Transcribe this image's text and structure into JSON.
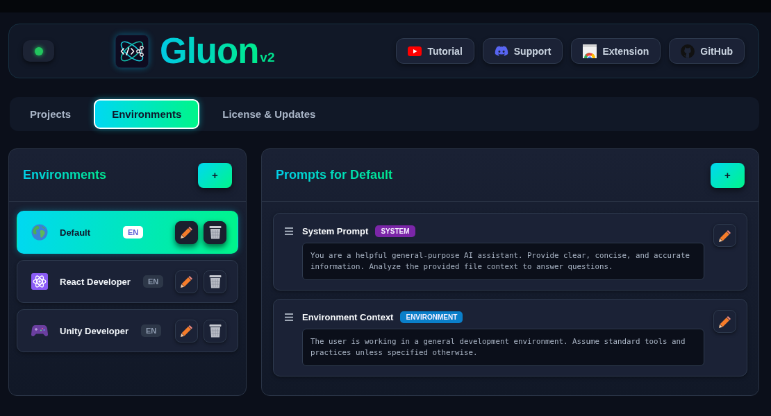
{
  "header": {
    "status": {
      "on": true
    },
    "logo": {
      "name": "Gluon",
      "version": "v2"
    },
    "links": [
      {
        "label": "Tutorial",
        "kind": "video"
      },
      {
        "label": "Support",
        "kind": "chat"
      },
      {
        "label": "Extension",
        "kind": "extension"
      },
      {
        "label": "GitHub",
        "kind": "repo"
      }
    ]
  },
  "tabs": [
    {
      "label": "Projects",
      "selected": false
    },
    {
      "label": "Environments",
      "selected": true
    },
    {
      "label": "License & Updates",
      "selected": false
    }
  ],
  "environments_panel": {
    "title": "Environments",
    "add_button": "+",
    "items": [
      {
        "name": "Default",
        "kind": "globe",
        "language": "EN",
        "selected": true
      },
      {
        "name": "React Developer",
        "kind": "atom",
        "language": "EN",
        "selected": false
      },
      {
        "name": "Unity Developer",
        "kind": "gamepad",
        "language": "EN",
        "selected": false
      }
    ]
  },
  "prompts_panel": {
    "title": "Prompts for Default",
    "add_button": "+",
    "prompts": [
      {
        "title": "System Prompt",
        "tag": "SYSTEM",
        "color": "#7b26a8",
        "text": "You are a helpful general-purpose AI assistant. Provide clear, concise, and accurate information. Analyze the provided file context to answer questions."
      },
      {
        "title": "Environment Context",
        "tag": "ENVIRONMENT",
        "color": "#0a7fca",
        "text": "The user is working in a general development environment. Assume standard tools and practices unless specified otherwise."
      }
    ]
  }
}
